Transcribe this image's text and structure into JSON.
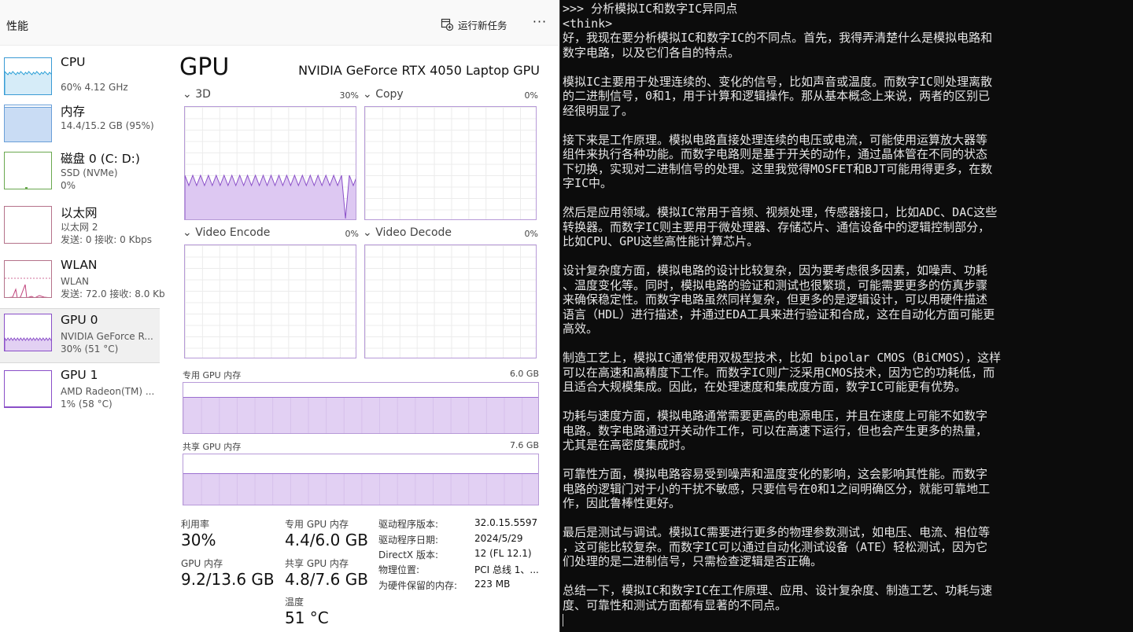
{
  "taskmgr": {
    "section_title": "性能",
    "run_new_task_label": "运行新任务",
    "more_label": "···",
    "sidebar": [
      {
        "name": "CPU",
        "sub1": "60% 4.12 GHz",
        "sub2": "",
        "sub3": ""
      },
      {
        "name": "内存",
        "sub1": "14.4/15.2 GB (95%)",
        "sub2": "",
        "sub3": ""
      },
      {
        "name": "磁盘 0 (C: D:)",
        "sub1": "SSD (NVMe)",
        "sub2": "0%",
        "sub3": ""
      },
      {
        "name": "以太网",
        "sub1": "以太网 2",
        "sub2": "发送: 0 接收: 0 Kbps",
        "sub3": ""
      },
      {
        "name": "WLAN",
        "sub1": "WLAN",
        "sub2": "发送: 72.0 接收: 8.0 Kb",
        "sub3": ""
      },
      {
        "name": "GPU 0",
        "sub1": "NVIDIA GeForce R...",
        "sub2": "30% (51 °C)",
        "sub3": ""
      },
      {
        "name": "GPU 1",
        "sub1": "AMD Radeon(TM) ...",
        "sub2": "1% (58 °C)",
        "sub3": ""
      }
    ],
    "gpu": {
      "title": "GPU",
      "model": "NVIDIA GeForce RTX 4050 Laptop GPU",
      "engines": [
        {
          "label": "3D",
          "percent": "30%"
        },
        {
          "label": "Copy",
          "percent": "0%"
        },
        {
          "label": "Video Encode",
          "percent": "0%"
        },
        {
          "label": "Video Decode",
          "percent": "0%"
        }
      ],
      "dedicated_mem_label": "专用 GPU 内存",
      "dedicated_mem_max": "6.0 GB",
      "dedicated_mem_fraction": 0.73,
      "shared_mem_label": "共享 GPU 内存",
      "shared_mem_max": "7.6 GB",
      "shared_mem_fraction": 0.63,
      "stats": {
        "utilization_label": "利用率",
        "utilization_value": "30%",
        "gpu_mem_label": "GPU 内存",
        "gpu_mem_value": "9.2/13.6 GB",
        "dedicated_label": "专用 GPU 内存",
        "dedicated_value": "4.4/6.0 GB",
        "shared_label": "共享 GPU 内存",
        "shared_value": "4.8/7.6 GB",
        "temp_label": "温度",
        "temp_value": "51 °C"
      },
      "info": [
        {
          "k": "驱动程序版本:",
          "v": "32.0.15.5597"
        },
        {
          "k": "驱动程序日期:",
          "v": "2024/5/29"
        },
        {
          "k": "DirectX 版本:",
          "v": "12 (FL 12.1)"
        },
        {
          "k": "物理位置:",
          "v": "PCI 总线 1、..."
        },
        {
          "k": "为硬件保留的内存:",
          "v": "223 MB"
        }
      ]
    },
    "colors": {
      "cpu": "#2a9fd6",
      "memory": "#6a9fd8",
      "gpu": "#8a4fc8",
      "gpu_fill": "#e2d0f3"
    }
  },
  "terminal": {
    "lines": [
      ">>> 分析模拟IC和数字IC异同点",
      "<think>",
      "好，我现在要分析模拟IC和数字IC的不同点。首先，我得弄清楚什么是模拟电路和",
      "数字电路，以及它们各自的特点。",
      "",
      "模拟IC主要用于处理连续的、变化的信号，比如声音或温度。而数字IC则处理离散",
      "的二进制信号，0和1，用于计算和逻辑操作。那从基本概念上来说，两者的区别已",
      "经很明显了。",
      "",
      "接下来是工作原理。模拟电路直接处理连续的电压或电流，可能使用运算放大器等",
      "组件来执行各种功能。而数字电路则是基于开关的动作，通过晶体管在不同的状态",
      "下切换，实现对二进制信号的处理。这里我觉得MOSFET和BJT可能用得更多，在数",
      "字IC中。",
      "",
      "然后是应用领域。模拟IC常用于音频、视频处理，传感器接口，比如ADC、DAC这些",
      "转换器。而数字IC则主要用于微处理器、存储芯片、通信设备中的逻辑控制部分，",
      "比如CPU、GPU这些高性能计算芯片。",
      "",
      "设计复杂度方面，模拟电路的设计比较复杂，因为要考虑很多因素，如噪声、功耗",
      "、温度变化等。同时，模拟电路的验证和测试也很繁琐，可能需要更多的仿真步骤",
      "来确保稳定性。而数字电路虽然同样复杂，但更多的是逻辑设计，可以用硬件描述",
      "语言（HDL）进行描述，并通过EDA工具来进行验证和合成，这在自动化方面可能更",
      "高效。",
      "",
      "制造工艺上，模拟IC通常使用双极型技术，比如 bipolar CMOS（BiCMOS），这样",
      "可以在高速和高精度下工作。而数字IC则广泛采用CMOS技术，因为它的功耗低，而",
      "且适合大规模集成。因此，在处理速度和集成度方面，数字IC可能更有优势。",
      "",
      "功耗与速度方面，模拟电路通常需要更高的电源电压，并且在速度上可能不如数字",
      "电路。数字电路通过开关动作工作，可以在高速下运行，但也会产生更多的热量，",
      "尤其是在高密度集成时。",
      "",
      "可靠性方面，模拟电路容易受到噪声和温度变化的影响，这会影响其性能。而数字",
      "电路的逻辑门对于小的干扰不敏感，只要信号在0和1之间明确区分，就能可靠地工",
      "作，因此鲁棒性更好。",
      "",
      "最后是测试与调试。模拟IC需要进行更多的物理参数测试，如电压、电流、相位等",
      "，这可能比较复杂。而数字IC可以通过自动化测试设备（ATE）轻松测试，因为它",
      "们处理的是二进制信号，只需检查逻辑是否正确。",
      "",
      "总结一下，模拟IC和数字IC在工作原理、应用、设计复杂度、制造工艺、功耗与速",
      "度、可靠性和测试方面都有显著的不同点。"
    ]
  }
}
